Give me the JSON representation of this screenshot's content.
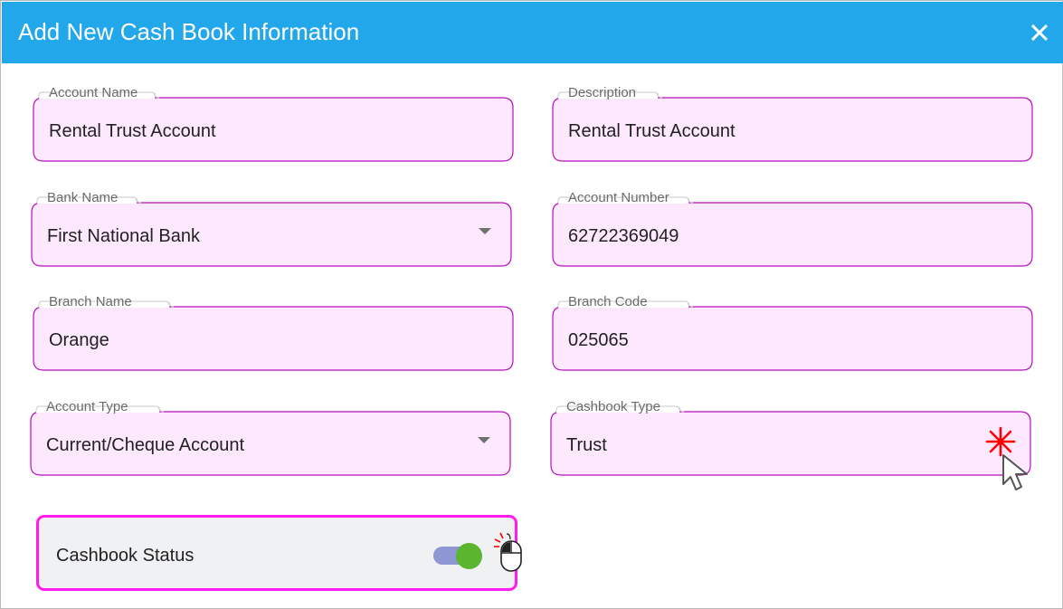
{
  "dialog": {
    "title": "Add New Cash Book Information",
    "close_icon": "close-icon"
  },
  "fields": {
    "account_name": {
      "label": "Account Name",
      "value": "Rental Trust Account"
    },
    "description": {
      "label": "Description",
      "value": "Rental Trust Account"
    },
    "bank_name": {
      "label": "Bank Name",
      "value": "First National Bank"
    },
    "account_number": {
      "label": "Account Number",
      "value": "62722369049"
    },
    "branch_name": {
      "label": "Branch Name",
      "value": "Orange"
    },
    "branch_code": {
      "label": "Branch Code",
      "value": "025065"
    },
    "account_type": {
      "label": "Account Type",
      "value": "Current/Cheque Account"
    },
    "cashbook_type": {
      "label": "Cashbook Type",
      "value": "Trust"
    }
  },
  "status": {
    "label": "Cashbook Status",
    "enabled": true
  },
  "colors": {
    "header": "#22a7ea",
    "field_fill": "#fde8fd",
    "field_border": "#b80fbd",
    "status_border": "#ff1cf0",
    "toggle_track": "#8e96d3",
    "toggle_knob": "#5bb52f",
    "click_marker": "#ff0000"
  }
}
